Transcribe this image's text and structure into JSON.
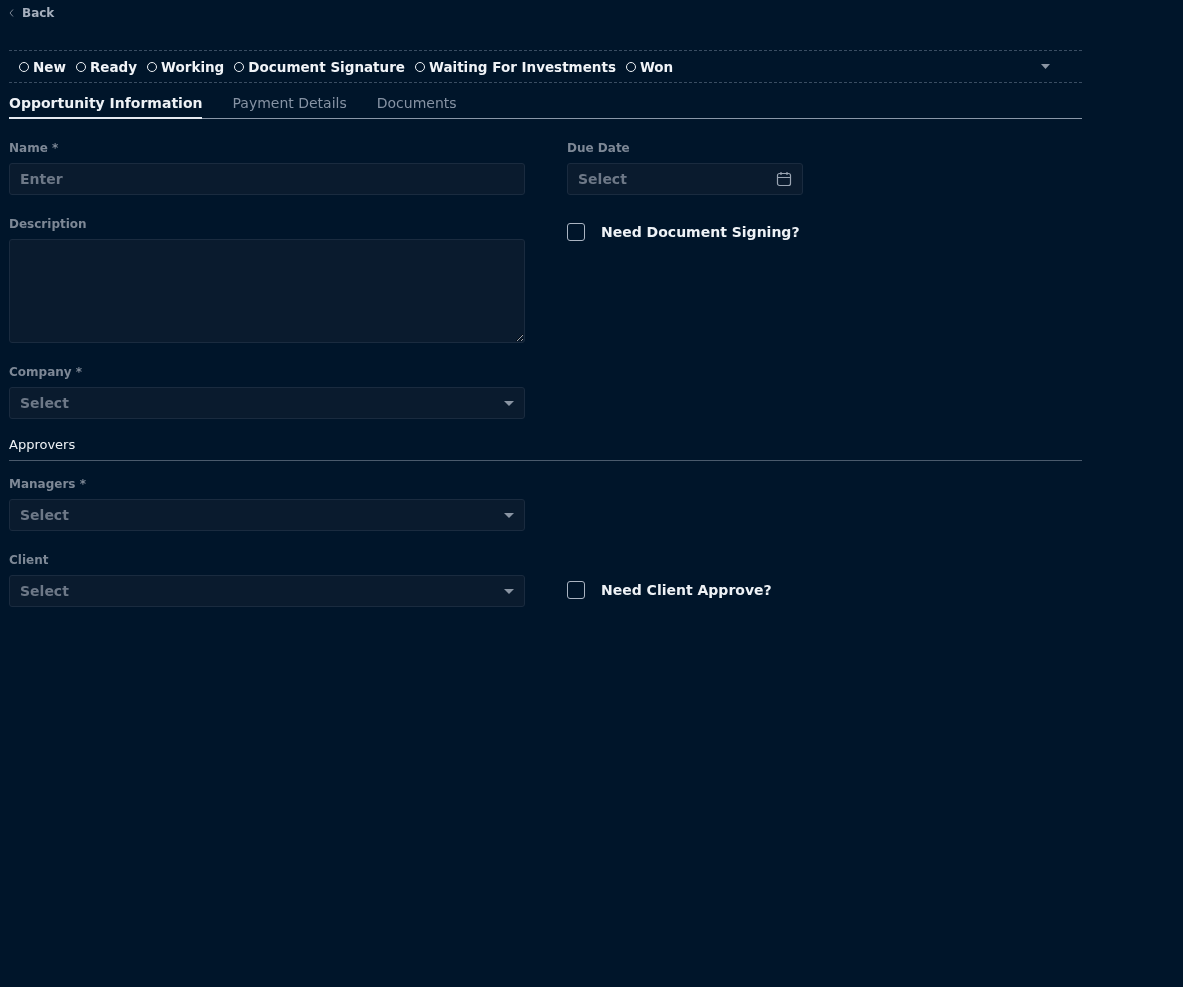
{
  "back": {
    "label": "Back"
  },
  "stages": [
    {
      "label": "New",
      "selected": false
    },
    {
      "label": "Ready",
      "selected": false
    },
    {
      "label": "Working",
      "selected": false
    },
    {
      "label": "Document Signature",
      "selected": false
    },
    {
      "label": "Waiting For Investments",
      "selected": false
    },
    {
      "label": "Won",
      "selected": false
    }
  ],
  "tabs": [
    {
      "label": "Opportunity Information",
      "selected": true
    },
    {
      "label": "Payment Details",
      "selected": false
    },
    {
      "label": "Documents",
      "selected": false
    }
  ],
  "form": {
    "name": {
      "label": "Name *",
      "placeholder": "Enter"
    },
    "due_date": {
      "label": "Due Date",
      "placeholder": "Select"
    },
    "description": {
      "label": "Description"
    },
    "need_document_signing": {
      "label": "Need Document Signing?",
      "checked": false
    },
    "company": {
      "label": "Company *",
      "placeholder": "Select"
    }
  },
  "approvers": {
    "title": "Approvers",
    "managers": {
      "label": "Managers *",
      "placeholder": "Select"
    },
    "client": {
      "label": "Client",
      "placeholder": "Select"
    },
    "need_client_approve": {
      "label": "Need Client Approve?",
      "checked": false
    }
  }
}
